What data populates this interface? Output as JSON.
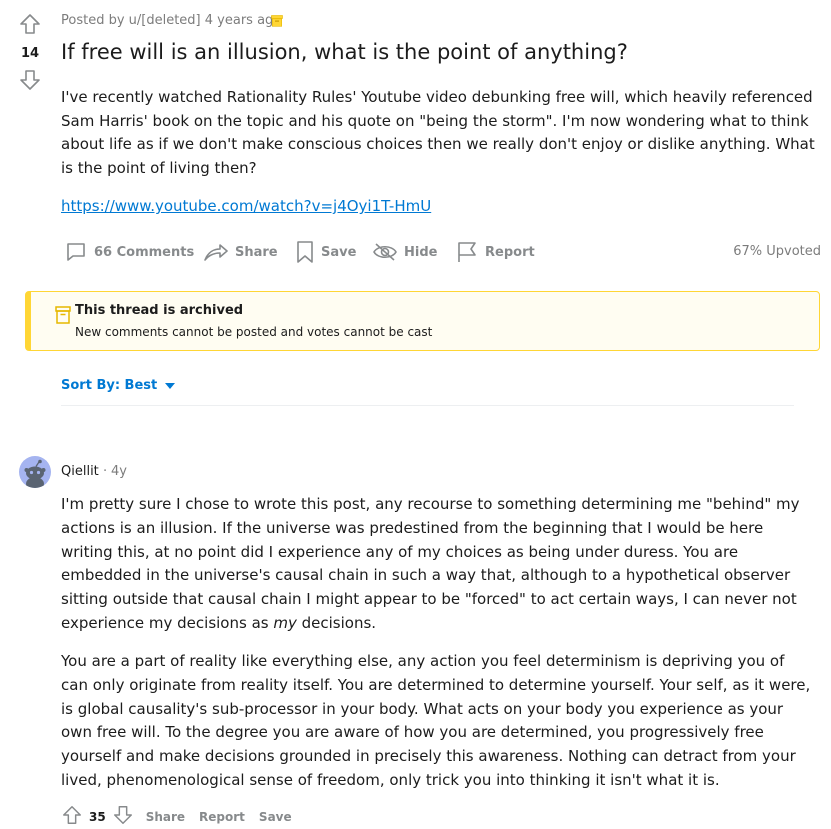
{
  "post": {
    "score": "14",
    "meta": "Posted by u/[deleted] 4 years ago",
    "title": "If free will is an illusion, what is the point of anything?",
    "body": "I've recently watched Rationality Rules' Youtube video debunking free will, which heavily referenced Sam Harris' book on the topic and his quote on \"being the storm\". I'm now wondering what to think about life as if we don't make conscious choices then we really don't enjoy or dislike anything. What is the point of living then?",
    "link": "https://www.youtube.com/watch?v=j4Oyi1T-HmU"
  },
  "actions": {
    "comments": "66 Comments",
    "share": "Share",
    "save": "Save",
    "hide": "Hide",
    "report": "Report",
    "upvoted": "67% Upvoted"
  },
  "archived": {
    "title": "This thread is archived",
    "subtitle": "New comments cannot be posted and votes cannot be cast"
  },
  "sort": {
    "label": "Sort By: Best"
  },
  "comment": {
    "author": "Qiellit",
    "separator": "·",
    "time": "4y",
    "p1_before": "I'm pretty sure I chose to wrote this post, any recourse to something determining me \"behind\" my actions is an illusion. If the universe was predestined from the beginning that I would be here writing this, at no point did I experience any of my choices as being under duress. You are embedded in the universe's causal chain in such a way that, although to a hypothetical observer sitting outside that causal chain I might appear to be \"forced\" to act certain ways, I can never not experience my decisions as ",
    "p1_emph": "my",
    "p1_after": " decisions.",
    "p2": "You are a part of reality like everything else, any action you feel determinism is depriving you of can only originate from reality itself. You are determined to determine yourself. Your self, as it were, is global causality's sub-processor in your body. What acts on your body you experience as your own free will. To the degree you are aware of how you are determined, you progressively free yourself and make decisions grounded in precisely this awareness. Nothing can detract from your lived, phenomenological sense of freedom, only trick you into thinking it isn't what it is.",
    "score": "35",
    "share": "Share",
    "report": "Report",
    "save": "Save"
  },
  "icons": {
    "upvote": "upvote-arrow-icon",
    "downvote": "downvote-arrow-icon",
    "archive": "archive-box-icon",
    "comment": "comment-bubble-icon",
    "share": "share-arrow-icon",
    "save": "bookmark-icon",
    "hide": "hide-eye-icon",
    "report": "flag-icon",
    "sort": "caret-down-icon"
  },
  "colors": {
    "accent": "#0079d3",
    "archive_yellow": "#ffd635",
    "muted": "#878a8c"
  }
}
